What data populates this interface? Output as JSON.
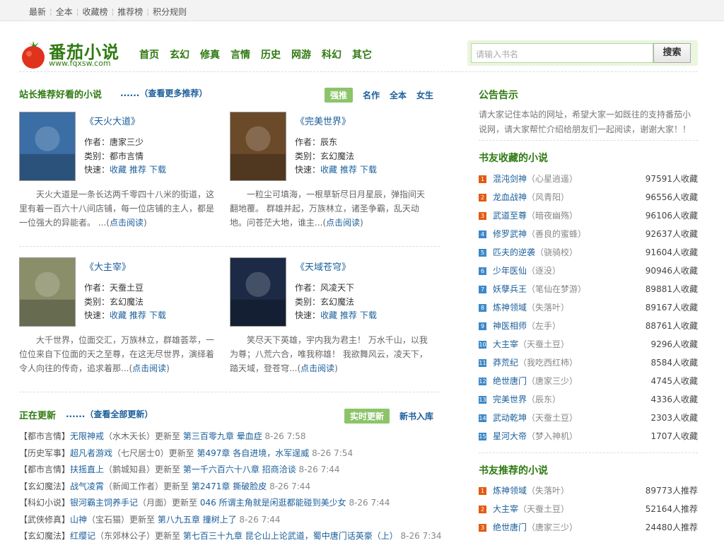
{
  "topbar": {
    "links": [
      "最新",
      "全本",
      "收藏榜",
      "推荐榜",
      "积分规则"
    ]
  },
  "logo": {
    "name": "番茄小说",
    "url": "www.fqxsw.com"
  },
  "nav": [
    "首页",
    "玄幻",
    "修真",
    "言情",
    "历史",
    "网游",
    "科幻",
    "其它"
  ],
  "search": {
    "placeholder": "请输入书名",
    "button": "搜索"
  },
  "recommend": {
    "title": "站长推荐好看的小说",
    "more": "......（查看更多推荐）",
    "tabs": [
      "强推",
      "名作",
      "全本",
      "女生"
    ],
    "labels": {
      "author": "作者：",
      "category": "类别：",
      "quick": "快速：",
      "fav": "收藏",
      "rec": "推荐",
      "dl": "下载",
      "read": "点击阅读"
    },
    "books": [
      {
        "title": "《天火大道》",
        "author": "唐家三少",
        "category": "都市言情",
        "desc": "天火大道是一条长达两千零四十八米的街道，这里有着一百六十八间店铺，每一位店铺的主人，都是一位强大的异能者。 ...",
        "cover_color": "#3a6ea5"
      },
      {
        "title": "《完美世界》",
        "author": "辰东",
        "category": "玄幻魔法",
        "desc": "一粒尘可填海，一根草斩尽日月星辰，弹指间天翻地覆。 群雄并起，万族林立，诸圣争霸，乱天动地。问苍茫大地，谁主...",
        "cover_color": "#6b4a2a"
      },
      {
        "title": "《大主宰》",
        "author": "天蚕土豆",
        "category": "玄幻魔法",
        "desc": "大千世界，位面交汇，万族林立，群雄荟萃，一位位来自下位面的天之至尊，在这无尽世界，演绎着令人向往的传奇，追求着那...",
        "cover_color": "#8a8f6a"
      },
      {
        "title": "《天域苍穹》",
        "author": "风凌天下",
        "category": "玄幻魔法",
        "desc": "笑尽天下英雄，宇内我为君主！ 万水千山，以我为尊；八荒六合，唯我称雄！ 我欲舞风云，凌天下，踏天域，登苍穹...",
        "cover_color": "#1c2a45"
      }
    ]
  },
  "updates": {
    "title": "正在更新",
    "more": "......（查看全部更新）",
    "tabs": [
      "实时更新",
      "新书入库"
    ],
    "upto": "更新至",
    "items": [
      {
        "cat": "【都市言情】",
        "name": "无限神戒",
        "author": "（水木天长）",
        "chapter": "第三百零九章 晕血症",
        "time": "8-26 7:58"
      },
      {
        "cat": "【历史军事】",
        "name": "超凡者游戏",
        "author": "（七尺居士0）",
        "chapter": "第497章 各自进境，水军逞威",
        "time": "8-26 7:54"
      },
      {
        "cat": "【都市言情】",
        "name": "扶摇直上",
        "author": "（鹅城知县）",
        "chapter": "第一千六百六十八章 招商洽谈",
        "time": "8-26 7:44"
      },
      {
        "cat": "【玄幻魔法】",
        "name": "战气凌霄",
        "author": "（新闻工作者）",
        "chapter": "第2471章 撕破脸皮",
        "time": "8-26 7:44"
      },
      {
        "cat": "【科幻小说】",
        "name": "银河霸主饲养手记",
        "author": "（月面）",
        "chapter": "046 所谓主角就是闲逛都能碰到美少女",
        "time": "8-26 7:44"
      },
      {
        "cat": "【武侠修真】",
        "name": "山神",
        "author": "（宝石猫）",
        "chapter": "第八九五章 撞树上了",
        "time": "8-26 7:44"
      },
      {
        "cat": "【玄幻魔法】",
        "name": "红缨记",
        "author": "（东郊林公子）",
        "chapter": "第七百三十九章 昆仑山上论武道，蜀中唐门话英豪（上）",
        "time": "8-26 7:34"
      }
    ]
  },
  "notice": {
    "title": "公告告示",
    "text": "请大家记住本站的网址，希望大家一如既往的支持番茄小说网，请大家帮忙介绍给朋友们一起阅读，谢谢大家！！"
  },
  "favorites": {
    "title": "书友收藏的小说",
    "unit": "人收藏",
    "items": [
      {
        "rank": "1",
        "name": "混沌剑神",
        "author": "（心星逍遥）",
        "count": "97591"
      },
      {
        "rank": "2",
        "name": "龙血战神",
        "author": "（风青阳）",
        "count": "96556"
      },
      {
        "rank": "3",
        "name": "武道至尊",
        "author": "（暗夜幽殇）",
        "count": "96106"
      },
      {
        "rank": "4",
        "name": "修罗武神",
        "author": "（善良的蜜蜂）",
        "count": "92637"
      },
      {
        "rank": "5",
        "name": "匹夫的逆袭",
        "author": "（骁骑校）",
        "count": "91604"
      },
      {
        "rank": "6",
        "name": "少年医仙",
        "author": "（逐没）",
        "count": "90946"
      },
      {
        "rank": "7",
        "name": "妖孽兵王",
        "author": "（笔仙在梦游）",
        "count": "89881"
      },
      {
        "rank": "8",
        "name": "炼神领域",
        "author": "（失落叶）",
        "count": "89167"
      },
      {
        "rank": "9",
        "name": "神医相师",
        "author": "（左手）",
        "count": "88761"
      },
      {
        "rank": "10",
        "name": "大主宰",
        "author": "（天蚕土豆）",
        "count": "9296"
      },
      {
        "rank": "11",
        "name": "莽荒纪",
        "author": "（我吃西红柿）",
        "count": "8584"
      },
      {
        "rank": "12",
        "name": "绝世唐门",
        "author": "（唐家三少）",
        "count": "4745"
      },
      {
        "rank": "13",
        "name": "完美世界",
        "author": "（辰东）",
        "count": "4336"
      },
      {
        "rank": "14",
        "name": "武动乾坤",
        "author": "（天蚕土豆）",
        "count": "2303"
      },
      {
        "rank": "15",
        "name": "星河大帝",
        "author": "（梦入神机）",
        "count": "1707"
      }
    ]
  },
  "recommended": {
    "title": "书友推荐的小说",
    "unit": "人推荐",
    "items": [
      {
        "rank": "1",
        "name": "炼神领域",
        "author": "（失落叶）",
        "count": "89773"
      },
      {
        "rank": "2",
        "name": "大主宰",
        "author": "（天蚕土豆）",
        "count": "52164"
      },
      {
        "rank": "3",
        "name": "绝世唐门",
        "author": "（唐家三少）",
        "count": "24480"
      }
    ]
  }
}
